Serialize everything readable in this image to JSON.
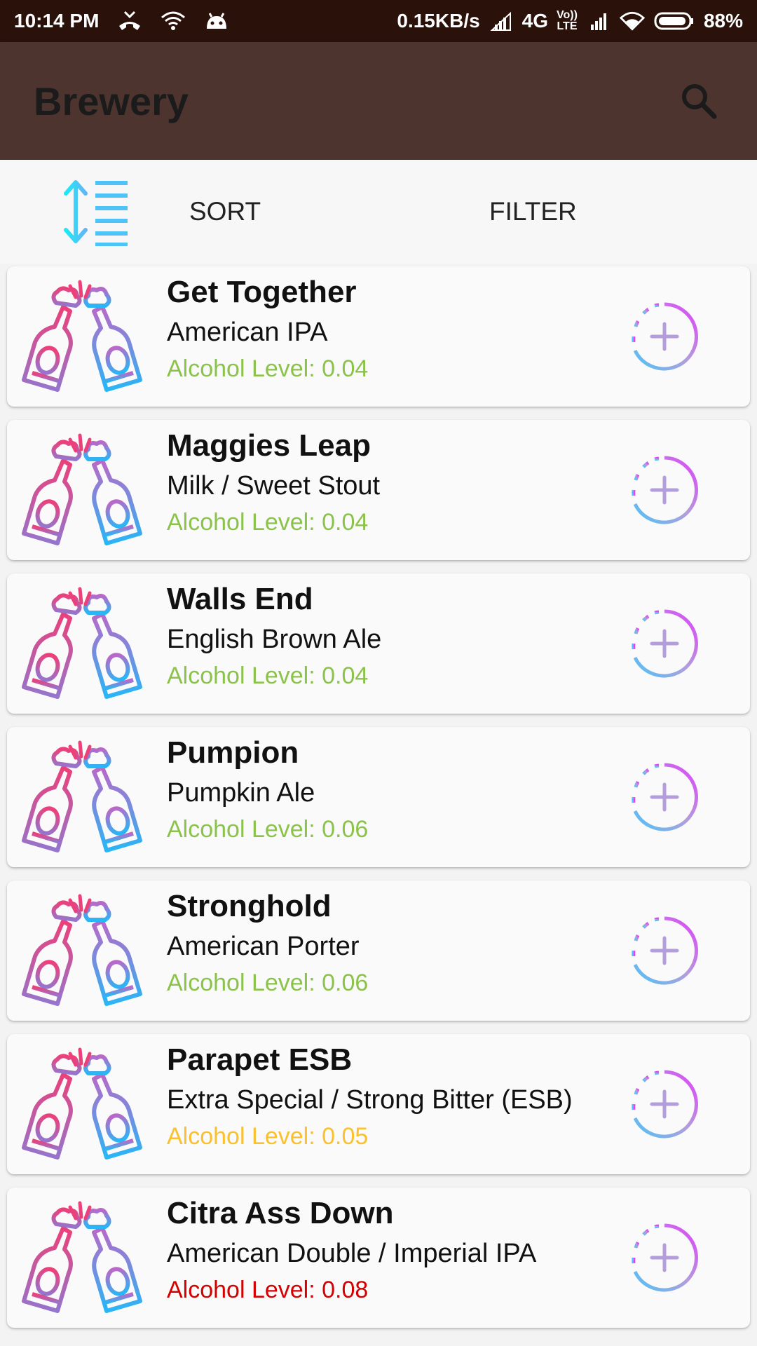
{
  "status_bar": {
    "time": "10:14 PM",
    "speed": "0.15KB/s",
    "network": "4G",
    "volte_top": "Vo))",
    "volte_bottom": "LTE",
    "battery": "88%"
  },
  "app_bar": {
    "title": "Brewery",
    "search_icon": "search-icon"
  },
  "toolbar": {
    "sort_label": "SORT",
    "filter_label": "FILTER"
  },
  "colors": {
    "abv_green": "#8bc34a",
    "abv_yellow": "#fbc02d",
    "abv_red": "#d50000",
    "app_bar": "#4e342e",
    "status_bar": "#2a110a"
  },
  "beers": [
    {
      "name": "Get Together",
      "style": "American IPA",
      "abv": "Alcohol Level: 0.04",
      "abv_color": "#8bc34a"
    },
    {
      "name": "Maggies Leap",
      "style": "Milk / Sweet Stout",
      "abv": "Alcohol Level: 0.04",
      "abv_color": "#8bc34a"
    },
    {
      "name": "Walls End",
      "style": "English Brown Ale",
      "abv": "Alcohol Level: 0.04",
      "abv_color": "#8bc34a"
    },
    {
      "name": "Pumpion",
      "style": "Pumpkin Ale",
      "abv": "Alcohol Level: 0.06",
      "abv_color": "#8bc34a"
    },
    {
      "name": "Stronghold",
      "style": "American Porter",
      "abv": "Alcohol Level: 0.06",
      "abv_color": "#8bc34a"
    },
    {
      "name": "Parapet ESB",
      "style": "Extra Special / Strong Bitter (ESB)",
      "abv": "Alcohol Level: 0.05",
      "abv_color": "#fbc02d"
    },
    {
      "name": "Citra Ass Down",
      "style": "American Double / Imperial IPA",
      "abv": "Alcohol Level: 0.08",
      "abv_color": "#d50000"
    }
  ]
}
